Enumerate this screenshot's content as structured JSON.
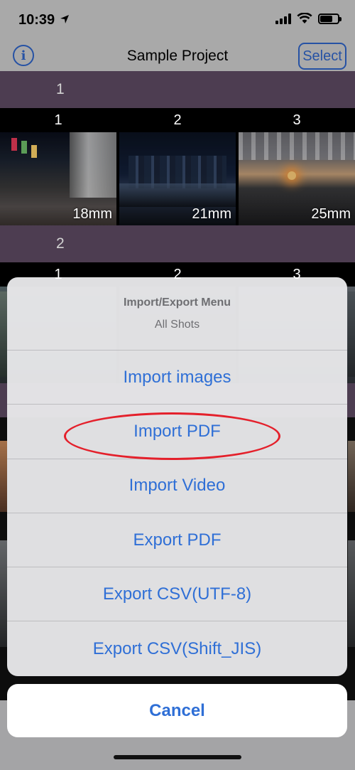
{
  "status_bar": {
    "time": "10:39"
  },
  "nav": {
    "title": "Sample Project",
    "select_label": "Select",
    "info_label": "i"
  },
  "sections": [
    {
      "label": "1",
      "photos": [
        {
          "number": "1",
          "focal": "18mm"
        },
        {
          "number": "2",
          "focal": "21mm"
        },
        {
          "number": "3",
          "focal": "25mm"
        }
      ]
    },
    {
      "label": "2",
      "photos": [
        {
          "number": "1"
        },
        {
          "number": "2"
        },
        {
          "number": "3"
        }
      ]
    }
  ],
  "action_sheet": {
    "title": "Import/Export Menu",
    "subtitle": "All Shots",
    "options": [
      "Import images",
      "Import PDF",
      "Import Video",
      "Export PDF",
      "Export CSV(UTF-8)",
      "Export CSV(Shift_JIS)"
    ],
    "cancel_label": "Cancel"
  },
  "colors": {
    "accent": "#2f6fd6",
    "section_header": "#5e4b63",
    "highlight": "#e4202b"
  }
}
